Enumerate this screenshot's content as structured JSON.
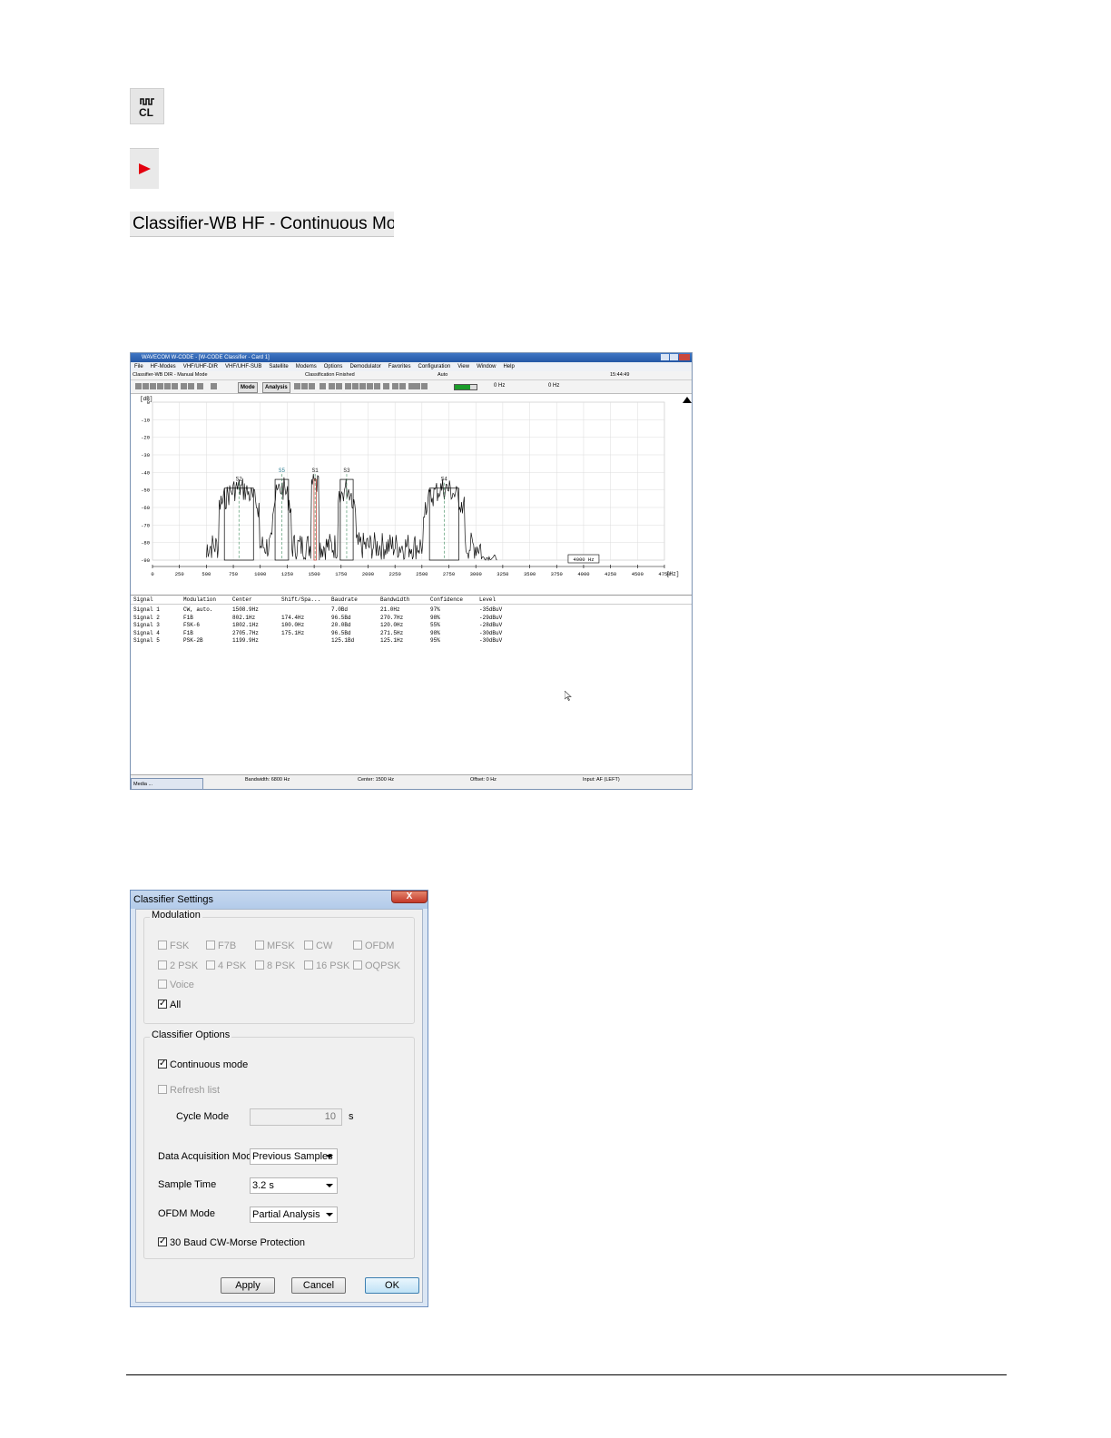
{
  "caption": "Classifier-WB HF - Continuous Mode",
  "icons": {
    "classifier": "classifier-cl-icon",
    "start": "play-icon"
  },
  "app": {
    "title": "WAVECOM W-CODE - [W-CODE Classifier - Card 1]",
    "menu": [
      "File",
      "HF-Modes",
      "VHF/UHF-DIR",
      "VHF/UHF-SUB",
      "Satellite",
      "Modems",
      "Options",
      "Demodulator",
      "Favorites",
      "Configuration",
      "View",
      "Window",
      "Help"
    ],
    "status": {
      "mode": "Classifier-WB DIR - Manual Mode",
      "state": "Classification Finished",
      "auto": "Auto",
      "time": "15:44:49"
    },
    "toolbar": {
      "mode_label": "Mode",
      "analysis_label": "Analysis",
      "hz_left": "0 Hz",
      "hz_right": "0 Hz"
    },
    "chart_data": {
      "type": "line",
      "ylabel": "[dB]",
      "xlabel": "[Hz]",
      "yticks": [
        "0",
        "-10",
        "-20",
        "-30",
        "-40",
        "-50",
        "-60",
        "-70",
        "-80",
        "-90"
      ],
      "xticks": [
        "0",
        "250",
        "500",
        "750",
        "1000",
        "1250",
        "1500",
        "1750",
        "2000",
        "2250",
        "2500",
        "2750",
        "3000",
        "3250",
        "3500",
        "3750",
        "4000",
        "4250",
        "4500",
        "4750"
      ],
      "ylim": [
        -90,
        0
      ],
      "xlim": [
        0,
        4750
      ],
      "marker_label": "4000 Hz",
      "signals": [
        {
          "name": "S2",
          "center": 802,
          "bw": 270
        },
        {
          "name": "S5",
          "center": 1200,
          "bw": 125
        },
        {
          "name": "S1",
          "center": 1509,
          "bw": 21
        },
        {
          "name": "S3",
          "center": 1802,
          "bw": 120
        },
        {
          "name": "S4",
          "center": 2706,
          "bw": 272
        }
      ]
    },
    "table": {
      "headers": [
        "Signal",
        "Modulation",
        "Center",
        "Shift/Spa...",
        "Baudrate",
        "Bandwidth",
        "Confidence",
        "Level"
      ],
      "rows": [
        [
          "Signal 1",
          "CW, auto.",
          "1508.9Hz",
          "",
          "7.0Bd",
          "21.0Hz",
          "97%",
          "-35dBuV"
        ],
        [
          "Signal 2",
          "F1B",
          "802.1Hz",
          "174.4Hz",
          "96.5Bd",
          "270.7Hz",
          "98%",
          "-29dBuV"
        ],
        [
          "Signal 3",
          "FSK-6",
          "1802.1Hz",
          "100.0Hz",
          "20.0Bd",
          "120.0Hz",
          "55%",
          "-28dBuV"
        ],
        [
          "Signal 4",
          "F1B",
          "2705.7Hz",
          "175.1Hz",
          "96.5Bd",
          "271.5Hz",
          "98%",
          "-30dBuV"
        ],
        [
          "Signal 5",
          "PSK-2B",
          "1199.9Hz",
          "",
          "125.1Bd",
          "125.1Hz",
          "95%",
          "-30dBuV"
        ]
      ]
    },
    "bottom": {
      "media": "Media ...",
      "bandwidth": "Bandwidth: 6800 Hz",
      "center": "Center: 1500 Hz",
      "offset": "Offset: 0 Hz",
      "input": "Input: AF (LEFT)"
    }
  },
  "dialog": {
    "title": "Classifier Settings",
    "close": "X",
    "modulation_group": "Modulation",
    "modulations": [
      {
        "label": "FSK",
        "checked": false
      },
      {
        "label": "F7B",
        "checked": false
      },
      {
        "label": "MFSK",
        "checked": false
      },
      {
        "label": "CW",
        "checked": false
      },
      {
        "label": "OFDM",
        "checked": false
      },
      {
        "label": "2 PSK",
        "checked": false
      },
      {
        "label": "4 PSK",
        "checked": false
      },
      {
        "label": "8 PSK",
        "checked": false
      },
      {
        "label": "16 PSK",
        "checked": false
      },
      {
        "label": "OQPSK",
        "checked": false
      },
      {
        "label": "Voice",
        "checked": false
      }
    ],
    "all_label": "All",
    "options_group": "Classifier Options",
    "continuous_mode": "Continuous mode",
    "refresh_list": "Refresh list",
    "cycle_mode_label": "Cycle Mode",
    "cycle_mode_value": "10",
    "cycle_unit": "s",
    "acq_label": "Data Acquisition Mode",
    "acq_value": "Previous Samples",
    "sample_label": "Sample Time",
    "sample_value": "3.2 s",
    "ofdm_label": "OFDM Mode",
    "ofdm_value": "Partial Analysis",
    "cw_protection": "30 Baud CW-Morse Protection",
    "apply": "Apply",
    "cancel": "Cancel",
    "ok": "OK"
  }
}
